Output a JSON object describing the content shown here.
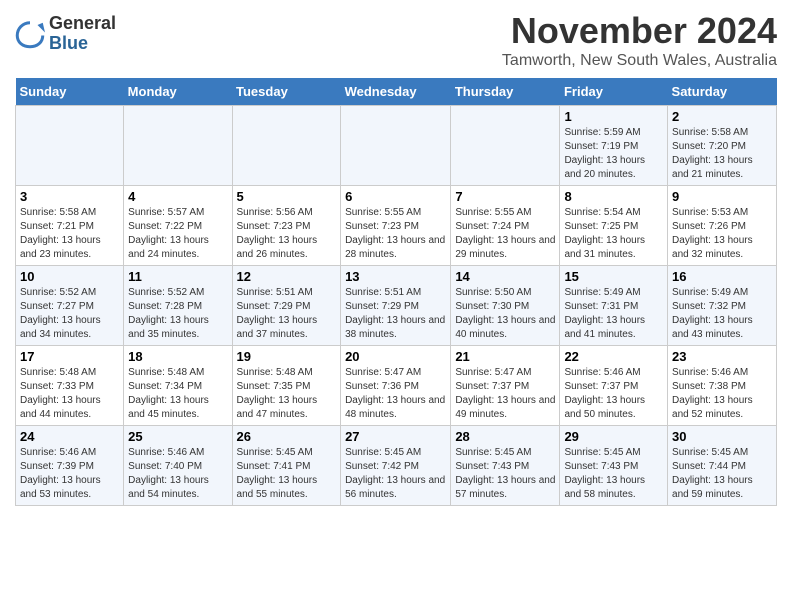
{
  "logo": {
    "general": "General",
    "blue": "Blue"
  },
  "title": "November 2024",
  "location": "Tamworth, New South Wales, Australia",
  "weekdays": [
    "Sunday",
    "Monday",
    "Tuesday",
    "Wednesday",
    "Thursday",
    "Friday",
    "Saturday"
  ],
  "weeks": [
    [
      {
        "day": "",
        "info": ""
      },
      {
        "day": "",
        "info": ""
      },
      {
        "day": "",
        "info": ""
      },
      {
        "day": "",
        "info": ""
      },
      {
        "day": "",
        "info": ""
      },
      {
        "day": "1",
        "info": "Sunrise: 5:59 AM\nSunset: 7:19 PM\nDaylight: 13 hours\nand 20 minutes."
      },
      {
        "day": "2",
        "info": "Sunrise: 5:58 AM\nSunset: 7:20 PM\nDaylight: 13 hours\nand 21 minutes."
      }
    ],
    [
      {
        "day": "3",
        "info": "Sunrise: 5:58 AM\nSunset: 7:21 PM\nDaylight: 13 hours\nand 23 minutes."
      },
      {
        "day": "4",
        "info": "Sunrise: 5:57 AM\nSunset: 7:22 PM\nDaylight: 13 hours\nand 24 minutes."
      },
      {
        "day": "5",
        "info": "Sunrise: 5:56 AM\nSunset: 7:23 PM\nDaylight: 13 hours\nand 26 minutes."
      },
      {
        "day": "6",
        "info": "Sunrise: 5:55 AM\nSunset: 7:23 PM\nDaylight: 13 hours\nand 28 minutes."
      },
      {
        "day": "7",
        "info": "Sunrise: 5:55 AM\nSunset: 7:24 PM\nDaylight: 13 hours\nand 29 minutes."
      },
      {
        "day": "8",
        "info": "Sunrise: 5:54 AM\nSunset: 7:25 PM\nDaylight: 13 hours\nand 31 minutes."
      },
      {
        "day": "9",
        "info": "Sunrise: 5:53 AM\nSunset: 7:26 PM\nDaylight: 13 hours\nand 32 minutes."
      }
    ],
    [
      {
        "day": "10",
        "info": "Sunrise: 5:52 AM\nSunset: 7:27 PM\nDaylight: 13 hours\nand 34 minutes."
      },
      {
        "day": "11",
        "info": "Sunrise: 5:52 AM\nSunset: 7:28 PM\nDaylight: 13 hours\nand 35 minutes."
      },
      {
        "day": "12",
        "info": "Sunrise: 5:51 AM\nSunset: 7:29 PM\nDaylight: 13 hours\nand 37 minutes."
      },
      {
        "day": "13",
        "info": "Sunrise: 5:51 AM\nSunset: 7:29 PM\nDaylight: 13 hours\nand 38 minutes."
      },
      {
        "day": "14",
        "info": "Sunrise: 5:50 AM\nSunset: 7:30 PM\nDaylight: 13 hours\nand 40 minutes."
      },
      {
        "day": "15",
        "info": "Sunrise: 5:49 AM\nSunset: 7:31 PM\nDaylight: 13 hours\nand 41 minutes."
      },
      {
        "day": "16",
        "info": "Sunrise: 5:49 AM\nSunset: 7:32 PM\nDaylight: 13 hours\nand 43 minutes."
      }
    ],
    [
      {
        "day": "17",
        "info": "Sunrise: 5:48 AM\nSunset: 7:33 PM\nDaylight: 13 hours\nand 44 minutes."
      },
      {
        "day": "18",
        "info": "Sunrise: 5:48 AM\nSunset: 7:34 PM\nDaylight: 13 hours\nand 45 minutes."
      },
      {
        "day": "19",
        "info": "Sunrise: 5:48 AM\nSunset: 7:35 PM\nDaylight: 13 hours\nand 47 minutes."
      },
      {
        "day": "20",
        "info": "Sunrise: 5:47 AM\nSunset: 7:36 PM\nDaylight: 13 hours\nand 48 minutes."
      },
      {
        "day": "21",
        "info": "Sunrise: 5:47 AM\nSunset: 7:37 PM\nDaylight: 13 hours\nand 49 minutes."
      },
      {
        "day": "22",
        "info": "Sunrise: 5:46 AM\nSunset: 7:37 PM\nDaylight: 13 hours\nand 50 minutes."
      },
      {
        "day": "23",
        "info": "Sunrise: 5:46 AM\nSunset: 7:38 PM\nDaylight: 13 hours\nand 52 minutes."
      }
    ],
    [
      {
        "day": "24",
        "info": "Sunrise: 5:46 AM\nSunset: 7:39 PM\nDaylight: 13 hours\nand 53 minutes."
      },
      {
        "day": "25",
        "info": "Sunrise: 5:46 AM\nSunset: 7:40 PM\nDaylight: 13 hours\nand 54 minutes."
      },
      {
        "day": "26",
        "info": "Sunrise: 5:45 AM\nSunset: 7:41 PM\nDaylight: 13 hours\nand 55 minutes."
      },
      {
        "day": "27",
        "info": "Sunrise: 5:45 AM\nSunset: 7:42 PM\nDaylight: 13 hours\nand 56 minutes."
      },
      {
        "day": "28",
        "info": "Sunrise: 5:45 AM\nSunset: 7:43 PM\nDaylight: 13 hours\nand 57 minutes."
      },
      {
        "day": "29",
        "info": "Sunrise: 5:45 AM\nSunset: 7:43 PM\nDaylight: 13 hours\nand 58 minutes."
      },
      {
        "day": "30",
        "info": "Sunrise: 5:45 AM\nSunset: 7:44 PM\nDaylight: 13 hours\nand 59 minutes."
      }
    ]
  ]
}
